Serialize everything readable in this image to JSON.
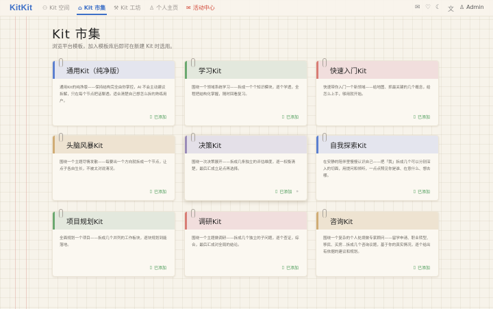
{
  "app": {
    "logo": "KitKit"
  },
  "nav": {
    "items": [
      {
        "label": "Kit 空间",
        "icon": "users-icon"
      },
      {
        "label": "Kit 市集",
        "icon": "store-icon",
        "active": true
      },
      {
        "label": "Kit 工坊",
        "icon": "wrench-icon"
      },
      {
        "label": "个人主页",
        "icon": "user-icon"
      },
      {
        "label": "活动中心",
        "icon": "gift-icon",
        "highlight": true
      }
    ],
    "right_icons": [
      "mail-icon",
      "heart-icon",
      "moon-icon",
      "translate-icon"
    ],
    "user": "Admin"
  },
  "page": {
    "title": "Kit 市集",
    "subtitle": "浏览平台模板，加入模板库后即可在新建 Kit 时选用。"
  },
  "cards": [
    {
      "title": "通用Kit（纯净版）",
      "desc": "通用Kit的纯净版——保持结构完全由你掌控，AI 不会主动建议拆解，只在每个节点把话聊透。适合清楚自己想怎么拆的熟练用户。",
      "status": "已添加",
      "color": "blue"
    },
    {
      "title": "学习Kit",
      "desc": "围绕一个领域系统学习——拆成一个个知识模块，逐个学透，全程把结构化掌握，随时回看复习。",
      "status": "已添加",
      "color": "green"
    },
    {
      "title": "快速入门Kit",
      "desc": "快速带你入门一个新领域——给地图、抓最关键的几个概念，给怎么上手，够用就开始。",
      "status": "已添加",
      "color": "red"
    },
    {
      "title": "头脑风暴Kit",
      "desc": "围绕一个主题尽情发散——每要出一个方向就拆成一个节点，让点子各自生长，不被太对说清况。",
      "status": "已添加",
      "color": "tan"
    },
    {
      "title": "决策Kit",
      "desc": "围绕一次决策展开——拆成几条独立的评估维度，逐一权衡清楚，最后汇成立足点再选择。",
      "status": "已添加",
      "color": "purple",
      "arrow": "»"
    },
    {
      "title": "自我探索Kit",
      "desc": "在安静的陪伴里慢慢认识自己——把「我」拆成几个可以分别深入的切面，用提问和倾听，一点点照见你是谁、在意什么、想去哪。",
      "status": "已添加",
      "color": "blue"
    },
    {
      "title": "项目规划Kit",
      "desc": "全面规划一个项目——拆成几个并列的工作板块，逐块规划到能落地。",
      "status": "已添加",
      "color": "green"
    },
    {
      "title": "调研Kit",
      "desc": "围绕一个主题做调研——拆成几个独立的子问题，逐个查证，综合，最后汇成对全局的结论。",
      "status": "已添加",
      "color": "red"
    },
    {
      "title": "咨询Kit",
      "desc": "围绕一个复杂的个人处境做专家顾问——留学申请、职业转型、移民、买房…拆成几个咨询议题，基于你的真实情况，逐个给出有依据的建议和规划。",
      "status": "已添加",
      "color": "tan"
    }
  ]
}
